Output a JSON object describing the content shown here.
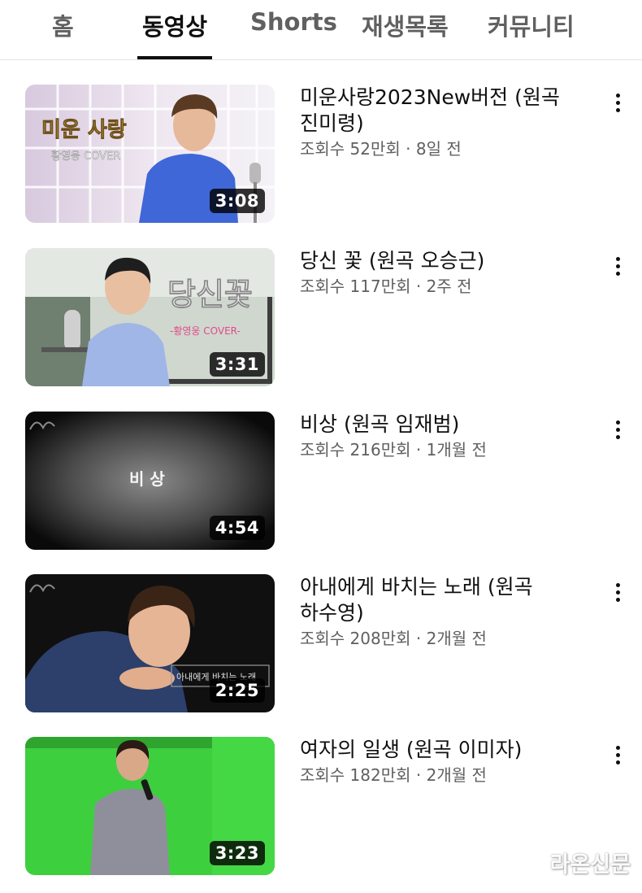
{
  "tabs": [
    {
      "label": "홈",
      "active": false
    },
    {
      "label": "동영상",
      "active": true
    },
    {
      "label": "Shorts",
      "active": false
    },
    {
      "label": "재생목록",
      "active": false
    },
    {
      "label": "커뮤니티",
      "active": false
    }
  ],
  "videos": [
    {
      "title": "미운사랑2023New버전 (원곡 진미령)",
      "stats": "조회수 52만회 · 8일 전",
      "duration": "3:08",
      "thumb_text": "미운 사랑",
      "thumb_subtext": "황영웅 COVER"
    },
    {
      "title": "당신 꽃 (원곡 오승근)",
      "stats": "조회수 117만회 · 2주 전",
      "duration": "3:31",
      "thumb_text": "당신꽃",
      "thumb_subtext": "-황영웅 COVER-"
    },
    {
      "title": "비상 (원곡 임재범)",
      "stats": "조회수 216만회 · 1개월 전",
      "duration": "4:54",
      "thumb_text": "비 상",
      "thumb_subtext": ""
    },
    {
      "title": "아내에게 바치는 노래 (원곡 하수영)",
      "stats": "조회수 208만회 · 2개월 전",
      "duration": "2:25",
      "thumb_text": "아내에게 바치는 노래",
      "thumb_subtext": ""
    },
    {
      "title": "여자의 일생 (원곡 이미자)",
      "stats": "조회수 182만회 · 2개월 전",
      "duration": "3:23",
      "thumb_text": "",
      "thumb_subtext": ""
    }
  ],
  "watermark": "라온신문",
  "icons": {
    "more": "more-vert-icon",
    "watermark_logo": "music-note-logo-icon"
  },
  "colors": {
    "active_tab": "#0f0f0f",
    "inactive_tab": "#606060",
    "meta_text": "#606060",
    "duration_bg": "#000000"
  }
}
